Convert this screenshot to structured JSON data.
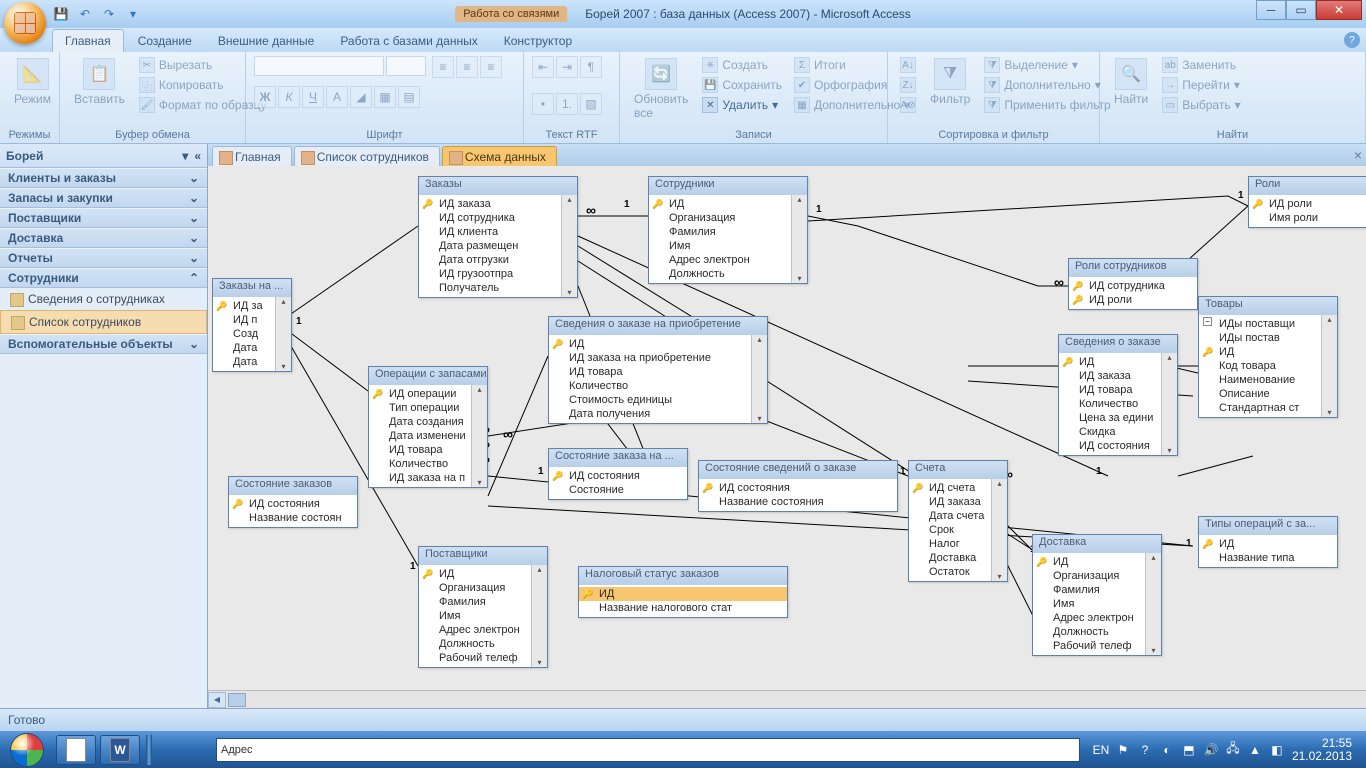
{
  "title": {
    "context_tab": "Работа со связями",
    "app_title": "Борей 2007 : база данных (Access 2007) - Microsoft Access"
  },
  "ribbon_tabs": [
    "Главная",
    "Создание",
    "Внешние данные",
    "Работа с базами данных",
    "Конструктор"
  ],
  "active_ribbon_tab": "Главная",
  "ribbon": {
    "groups": {
      "views": {
        "label": "Режимы",
        "btn": "Режим"
      },
      "clipboard": {
        "label": "Буфер обмена",
        "paste": "Вставить",
        "cut": "Вырезать",
        "copy": "Копировать",
        "fmtpainter": "Формат по образцу"
      },
      "font": {
        "label": "Шрифт"
      },
      "rtf": {
        "label": "Текст RTF"
      },
      "records": {
        "label": "Записи",
        "refresh": "Обновить все",
        "new": "Создать",
        "save": "Сохранить",
        "delete": "Удалить",
        "totals": "Итоги",
        "spell": "Орфография",
        "more": "Дополнительно"
      },
      "sortfilter": {
        "label": "Сортировка и фильтр",
        "filter": "Фильтр",
        "selection": "Выделение",
        "advanced": "Дополнительно",
        "toggle": "Применить фильтр"
      },
      "find": {
        "label": "Найти",
        "find": "Найти",
        "replace": "Заменить",
        "goto": "Перейти",
        "select": "Выбрать"
      }
    }
  },
  "navpane": {
    "title": "Борей",
    "groups": [
      {
        "name": "Клиенты и заказы",
        "expanded": false
      },
      {
        "name": "Запасы и закупки",
        "expanded": false
      },
      {
        "name": "Поставщики",
        "expanded": false
      },
      {
        "name": "Доставка",
        "expanded": false
      },
      {
        "name": "Отчеты",
        "expanded": false
      },
      {
        "name": "Сотрудники",
        "expanded": true,
        "items": [
          "Сведения о сотрудниках",
          "Список сотрудников"
        ]
      },
      {
        "name": "Вспомогательные объекты",
        "expanded": false
      }
    ]
  },
  "doctabs": [
    {
      "label": "Главная",
      "active": false
    },
    {
      "label": "Список сотрудников",
      "active": false
    },
    {
      "label": "Схема данных",
      "active": true
    }
  ],
  "tables": {
    "orders": {
      "title": "Заказы",
      "fields": [
        [
          "ИД заказа",
          true
        ],
        [
          "ИД сотрудника",
          false
        ],
        [
          "ИД клиента",
          false
        ],
        [
          "Дата размещен",
          false
        ],
        [
          "Дата отгрузки",
          false
        ],
        [
          "ИД грузоотпра",
          false
        ],
        [
          "Получатель",
          false
        ]
      ]
    },
    "employees": {
      "title": "Сотрудники",
      "fields": [
        [
          "ИД",
          true
        ],
        [
          "Организация",
          false
        ],
        [
          "Фамилия",
          false
        ],
        [
          "Имя",
          false
        ],
        [
          "Адрес электрон",
          false
        ],
        [
          "Должность",
          false
        ]
      ]
    },
    "roles": {
      "title": "Роли",
      "fields": [
        [
          "ИД роли",
          true
        ],
        [
          "Имя роли",
          false
        ]
      ]
    },
    "emp_roles": {
      "title": "Роли сотрудников",
      "fields": [
        [
          "ИД сотрудника",
          true
        ],
        [
          "ИД роли",
          true
        ]
      ]
    },
    "purchase_orders": {
      "title": "Заказы на ...",
      "fields": [
        [
          "ИД за",
          true
        ],
        [
          "ИД п",
          false
        ],
        [
          "Созд",
          false
        ],
        [
          "Дата",
          false
        ],
        [
          "Дата",
          false
        ]
      ]
    },
    "inventory": {
      "title": "Операции с запасами",
      "fields": [
        [
          "ИД операции",
          true
        ],
        [
          "Тип операции",
          false
        ],
        [
          "Дата создания",
          false
        ],
        [
          "Дата изменени",
          false
        ],
        [
          "ИД товара",
          false
        ],
        [
          "Количество",
          false
        ],
        [
          "ИД заказа на п",
          false
        ]
      ]
    },
    "po_details": {
      "title": "Сведения о заказе на приобретение",
      "fields": [
        [
          "ИД",
          true
        ],
        [
          "ИД заказа на приобретение",
          false
        ],
        [
          "ИД товара",
          false
        ],
        [
          "Количество",
          false
        ],
        [
          "Стоимость единицы",
          false
        ],
        [
          "Дата получения",
          false
        ]
      ]
    },
    "order_status": {
      "title": "Состояние заказов",
      "fields": [
        [
          "ИД состояния",
          true
        ],
        [
          "Название состоян",
          false
        ]
      ]
    },
    "po_status": {
      "title": "Состояние заказа на ...",
      "fields": [
        [
          "ИД состояния",
          true
        ],
        [
          "Состояние",
          false
        ]
      ]
    },
    "od_status": {
      "title": "Состояние сведений о заказе",
      "fields": [
        [
          "ИД состояния",
          true
        ],
        [
          "Название состояния",
          false
        ]
      ]
    },
    "invoices": {
      "title": "Счета",
      "fields": [
        [
          "ИД счета",
          true
        ],
        [
          "ИД заказа",
          false
        ],
        [
          "Дата счета",
          false
        ],
        [
          "Срок",
          false
        ],
        [
          "Налог",
          false
        ],
        [
          "Доставка",
          false
        ],
        [
          "Остаток",
          false
        ]
      ]
    },
    "order_details": {
      "title": "Сведения о заказе",
      "fields": [
        [
          "ИД",
          true
        ],
        [
          "ИД заказа",
          false
        ],
        [
          "ИД товара",
          false
        ],
        [
          "Количество",
          false
        ],
        [
          "Цена за едини",
          false
        ],
        [
          "Скидка",
          false
        ],
        [
          "ИД состояния",
          false
        ]
      ]
    },
    "products": {
      "title": "Товары",
      "fields": [
        [
          "ИДы поставщи",
          false
        ],
        [
          "ИДы постав",
          false
        ],
        [
          "ИД",
          true
        ],
        [
          "Код товара",
          false
        ],
        [
          "Наименование",
          false
        ],
        [
          "Описание",
          false
        ],
        [
          "Стандартная ст",
          false
        ]
      ],
      "expand": true
    },
    "suppliers": {
      "title": "Поставщики",
      "fields": [
        [
          "ИД",
          true
        ],
        [
          "Организация",
          false
        ],
        [
          "Фамилия",
          false
        ],
        [
          "Имя",
          false
        ],
        [
          "Адрес электрон",
          false
        ],
        [
          "Должность",
          false
        ],
        [
          "Рабочий телеф",
          false
        ]
      ]
    },
    "tax_status": {
      "title": "Налоговый статус заказов",
      "fields": [
        [
          "ИД",
          true
        ],
        [
          "Название налогового стат",
          false
        ]
      ],
      "selected_row": 0
    },
    "shippers": {
      "title": "Доставка",
      "fields": [
        [
          "ИД",
          true
        ],
        [
          "Организация",
          false
        ],
        [
          "Фамилия",
          false
        ],
        [
          "Имя",
          false
        ],
        [
          "Адрес электрон",
          false
        ],
        [
          "Должность",
          false
        ],
        [
          "Рабочий телеф",
          false
        ]
      ]
    },
    "inv_types": {
      "title": "Типы операций с за...",
      "fields": [
        [
          "ИД",
          true
        ],
        [
          "Название типа",
          false
        ]
      ]
    }
  },
  "statusbar": {
    "text": "Готово"
  },
  "taskbar": {
    "address_label": "Адрес",
    "lang": "EN",
    "time": "21:55",
    "date": "21.02.2013"
  }
}
